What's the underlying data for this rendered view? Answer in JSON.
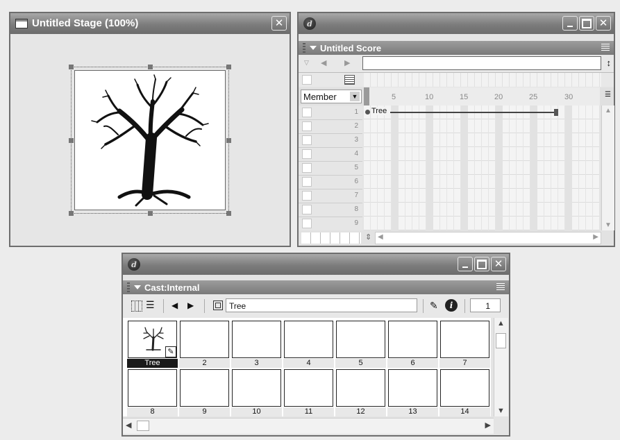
{
  "stage": {
    "title": "Untitled Stage (100%)"
  },
  "score": {
    "panel_title": "Untitled Score",
    "member_label": "Member",
    "frame_ticks": [
      "5",
      "10",
      "15",
      "20",
      "25",
      "30"
    ],
    "channels": [
      "1",
      "2",
      "3",
      "4",
      "5",
      "6",
      "7",
      "8",
      "9"
    ],
    "sprite_label": "Tree"
  },
  "cast": {
    "panel_title": "Cast:Internal",
    "member_name": "Tree",
    "member_number": "1",
    "members": [
      "Tree",
      "2",
      "3",
      "4",
      "5",
      "6",
      "7",
      "8",
      "9",
      "10",
      "11",
      "12",
      "13",
      "14"
    ]
  },
  "icons": {
    "stage": [
      "stage-window-icon",
      "close-icon"
    ],
    "score": [
      "macromedia-logo-icon",
      "minimize-icon",
      "maximize-icon",
      "close-icon",
      "options-menu-icon",
      "marker-icon",
      "previous-marker-icon",
      "next-marker-icon",
      "script-icon",
      "dropdown-icon",
      "expand-icon",
      "zoom-icon"
    ],
    "cast": [
      "macromedia-logo-icon",
      "minimize-icon",
      "maximize-icon",
      "close-icon",
      "options-menu-icon",
      "thumbnail-view-icon",
      "list-view-icon",
      "previous-member-icon",
      "next-member-icon",
      "drag-cast-member-icon",
      "script-icon",
      "member-info-icon"
    ]
  }
}
